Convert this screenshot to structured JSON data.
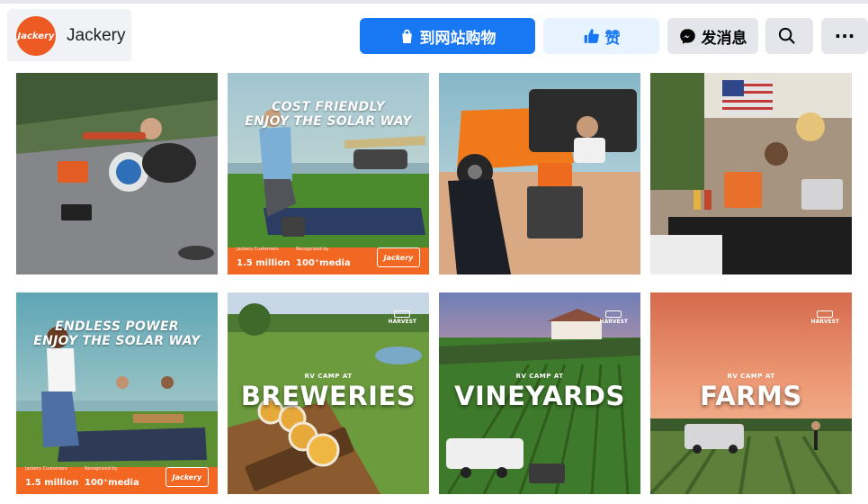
{
  "page": {
    "name": "Jackery",
    "avatar_text": "Jackery"
  },
  "actions": {
    "shop": "到网站购物",
    "like": "赞",
    "message": "发消息",
    "more": "···"
  },
  "icons": {
    "shop": "shopping-bag-icon",
    "like": "thumbs-up-icon",
    "message": "messenger-icon",
    "search": "search-icon",
    "more": "more-dots-icon"
  },
  "colors": {
    "primary": "#1877f2",
    "primary_light": "#e7f3ff",
    "button_gray": "#e4e6eb",
    "brand_orange": "#f26722"
  },
  "photos": [
    {
      "description": "drone-setup",
      "overlay": {}
    },
    {
      "overlay": {
        "line1": "COST FRIENDLY",
        "line2": "ENJOY THE SOLAR WAY",
        "stat1_small": "Jackery Customers",
        "stat1_num": "1.5 million",
        "stat2_small": "Recognized by",
        "stat2_num": "100⁺media",
        "badge": "Jackery"
      }
    },
    {
      "overlay": {}
    },
    {
      "overlay": {}
    },
    {
      "overlay": {
        "line1": "ENDLESS POWER",
        "line2": "ENJOY THE SOLAR WAY",
        "stat1_small": "Jackery Customers",
        "stat1_num": "1.5 million",
        "stat2_small": "Recognized by",
        "stat2_num": "100⁺media",
        "badge": "Jackery"
      }
    },
    {
      "overlay": {
        "caption": "RV CAMP AT",
        "title": "BREWERIES",
        "logo": "HARVEST"
      }
    },
    {
      "overlay": {
        "caption": "RV CAMP AT",
        "title": "VINEYARDS",
        "logo": "HARVEST"
      }
    },
    {
      "overlay": {
        "caption": "RV CAMP AT",
        "title": "FARMS",
        "logo": "HARVEST"
      }
    }
  ]
}
